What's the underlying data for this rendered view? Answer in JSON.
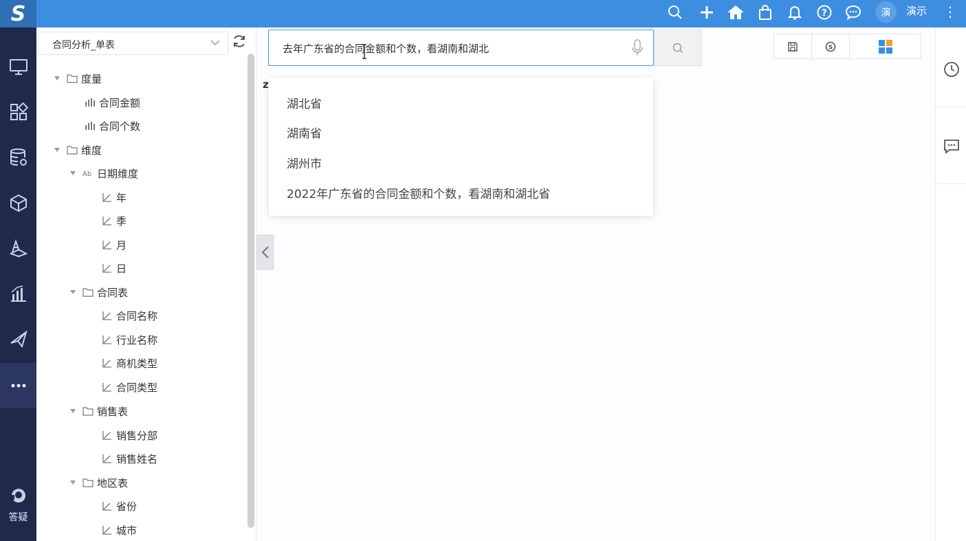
{
  "header": {
    "logo": "S",
    "user_avatar": "演",
    "user_name": "演示",
    "icons": [
      "search-icon",
      "plus-icon",
      "home-icon",
      "bag-icon",
      "bell-icon",
      "help-icon",
      "chat-icon",
      "more-vertical-icon"
    ]
  },
  "nav": {
    "items": [
      "monitor-icon",
      "apps-icon",
      "database-icon",
      "cube-icon",
      "layers-icon",
      "bar-chart-icon",
      "send-icon",
      "more-icon"
    ],
    "help_label": "答疑"
  },
  "tree": {
    "dataset": "合同分析_单表",
    "measures_folder": "度量",
    "measures": [
      "合同金额",
      "合同个数"
    ],
    "dimensions_folder": "维度",
    "date_dim": "日期维度",
    "date_items": [
      "年",
      "季",
      "月",
      "日"
    ],
    "contract_table": "合同表",
    "contract_items": [
      "合同名称",
      "行业名称",
      "商机类型",
      "合同类型"
    ],
    "sales_table": "销售表",
    "sales_items": [
      "销售分部",
      "销售姓名"
    ],
    "region_table": "地区表",
    "region_items": [
      "省份",
      "城市"
    ]
  },
  "search": {
    "query": "去年广东省的合同金额和个数，看湖南和湖北",
    "suggestions": [
      "湖北省",
      "湖南省",
      "湖州市",
      "2022年广东省的合同金额和个数，看湖南和湖北省"
    ]
  },
  "colors": {
    "topbar": "#3d8ee0",
    "nav": "#1f2a4b",
    "accent": "#4a8fe0"
  }
}
